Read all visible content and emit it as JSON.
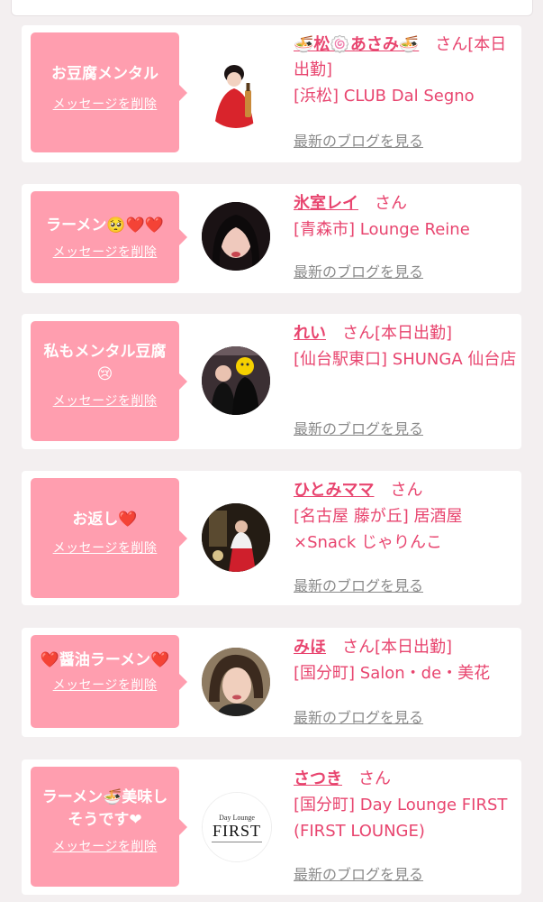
{
  "items": [
    {
      "message": "お豆腐メンタル",
      "delete_label": "メッセージを削除",
      "name": "🍜松🍥あさみ🍜",
      "san": "さん",
      "status": "[本日出勤]",
      "shop": "[浜松] CLUB Dal Segno",
      "blog_label": "最新のブログを見る"
    },
    {
      "message": "ラーメン🥺❤️❤️",
      "delete_label": "メッセージを削除",
      "name": "氷室レイ",
      "san": "さん",
      "status": "",
      "shop": "[青森市] Lounge Reine",
      "blog_label": "最新のブログを見る"
    },
    {
      "message": "私もメンタル豆腐😢",
      "delete_label": "メッセージを削除",
      "name": "れい",
      "san": "さん",
      "status": "[本日出勤]",
      "shop": "[仙台駅東口] SHUNGA 仙台店",
      "blog_label": "最新のブログを見る"
    },
    {
      "message": "お返し❤️",
      "delete_label": "メッセージを削除",
      "name": "ひとみママ",
      "san": "さん",
      "status": "",
      "shop": "[名古屋 藤が丘] 居酒屋×Snack じゃりんこ",
      "blog_label": "最新のブログを見る"
    },
    {
      "message": "❤️醤油ラーメン❤️",
      "delete_label": "メッセージを削除",
      "name": "みほ",
      "san": "さん",
      "status": "[本日出勤]",
      "shop": "[国分町] Salon・de・美花",
      "blog_label": "最新のブログを見る"
    },
    {
      "message": "ラーメン🍜美味しそうです❤",
      "delete_label": "メッセージを削除",
      "name": "さつき",
      "san": "さん",
      "status": "",
      "shop": "[国分町] Day Lounge FIRST (FIRST LOUNGE)",
      "blog_label": "最新のブログを見る",
      "logo_text": [
        "Day Lounge",
        "FIRST"
      ]
    }
  ],
  "colors": {
    "accent": "#e8456f",
    "bubble": "#ff9eaf",
    "background": "#f3eff0"
  }
}
